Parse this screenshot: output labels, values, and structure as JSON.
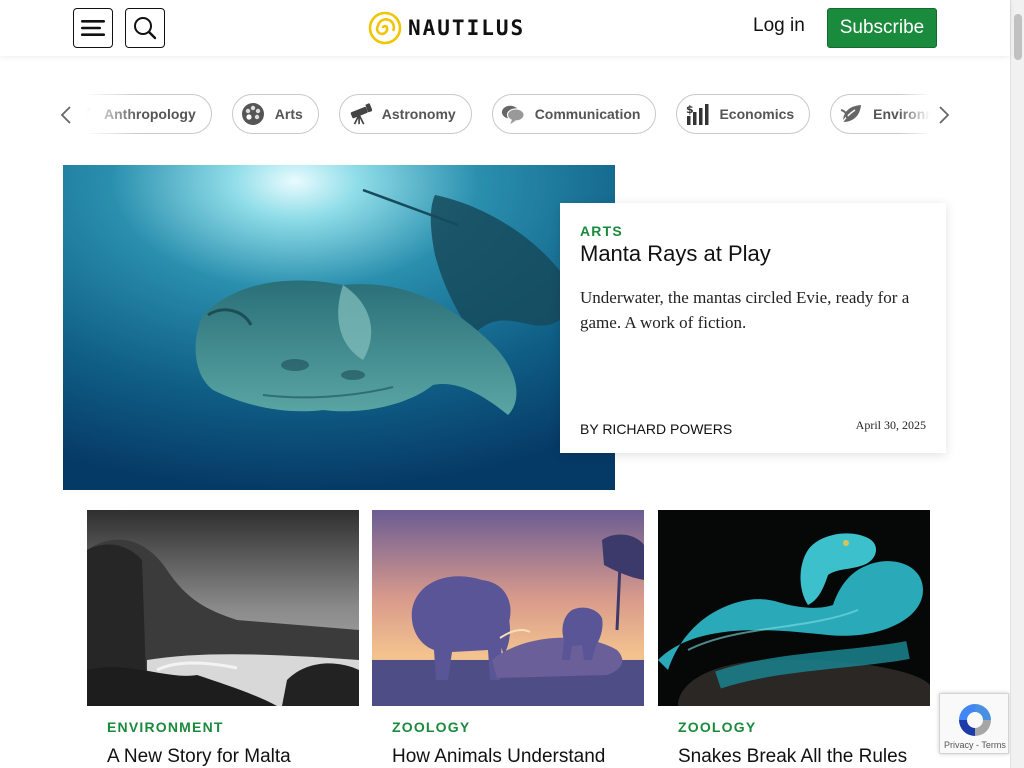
{
  "header": {
    "logo_text": "NAUTILUS",
    "login_label": "Log in",
    "subscribe_label": "Subscribe"
  },
  "categories": {
    "items": [
      {
        "label": "Anthropology",
        "icon": "anthropology-icon"
      },
      {
        "label": "Arts",
        "icon": "palette-icon"
      },
      {
        "label": "Astronomy",
        "icon": "telescope-icon"
      },
      {
        "label": "Communication",
        "icon": "speech-bubbles-icon"
      },
      {
        "label": "Economics",
        "icon": "dollar-chart-icon"
      },
      {
        "label": "Environment",
        "icon": "leaf-icon"
      }
    ]
  },
  "hero": {
    "kicker": "ARTS",
    "title": "Manta Rays at Play",
    "dek": "Underwater, the mantas circled Evie, ready for a game. A work of fiction.",
    "byline": "BY RICHARD POWERS",
    "date": "April 30, 2025"
  },
  "cards": [
    {
      "kicker": "ENVIRONMENT",
      "title": "A New Story for Malta"
    },
    {
      "kicker": "ZOOLOGY",
      "title": "How Animals Understand"
    },
    {
      "kicker": "ZOOLOGY",
      "title": "Snakes Break All the Rules"
    }
  ],
  "recaptcha": {
    "links": "Privacy - Terms"
  },
  "colors": {
    "accent_green": "#1a8a3c",
    "logo_yellow": "#f2c500"
  }
}
